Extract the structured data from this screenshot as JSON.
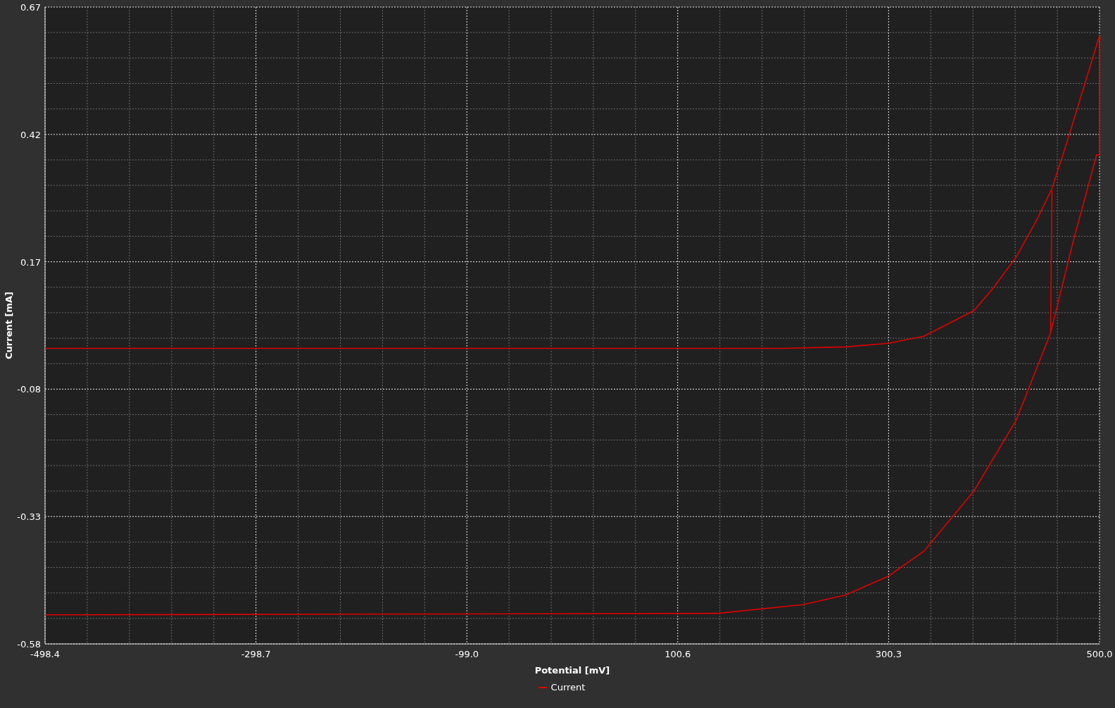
{
  "plot": {
    "chart_data": {
      "type": "line",
      "grid": true,
      "xlabel": "Potential [mV]",
      "ylabel": "Current [mA]",
      "xlim": [
        -498.4,
        500
      ],
      "ylim": [
        -0.58,
        0.67
      ],
      "xticks": [
        -498.4,
        -298.7,
        {
          "value": -99,
          "label": "-99.0"
        },
        100.6,
        300.3,
        {
          "value": 500,
          "label": "500.0"
        }
      ],
      "yticks": [
        0.67,
        0.42,
        0.17,
        -0.08,
        -0.33,
        -0.58
      ],
      "x": [
        -498.4,
        200,
        259.8,
        300.2,
        333.8,
        381.0,
        400,
        421.3,
        440,
        455.0,
        470,
        500,
        500,
        497.3,
        475.1,
        453.6,
        455,
        453.6,
        421.3,
        381.0,
        333.8,
        300.2,
        259.8,
        219.5,
        138.7,
        -498.4
      ],
      "series": [
        {
          "name": "Current",
          "color": "#e00000",
          "values": [
            0,
            0,
            0.003,
            0.01,
            0.024,
            0.074,
            0.12,
            0.18,
            0.25,
            0.314,
            0.41,
            0.614,
            0.38,
            0.38,
            0.21,
            0.03,
            0.31,
            0.03,
            -0.14,
            -0.28,
            -0.398,
            -0.447,
            -0.484,
            -0.503,
            -0.52,
            -0.523
          ]
        }
      ]
    }
  }
}
